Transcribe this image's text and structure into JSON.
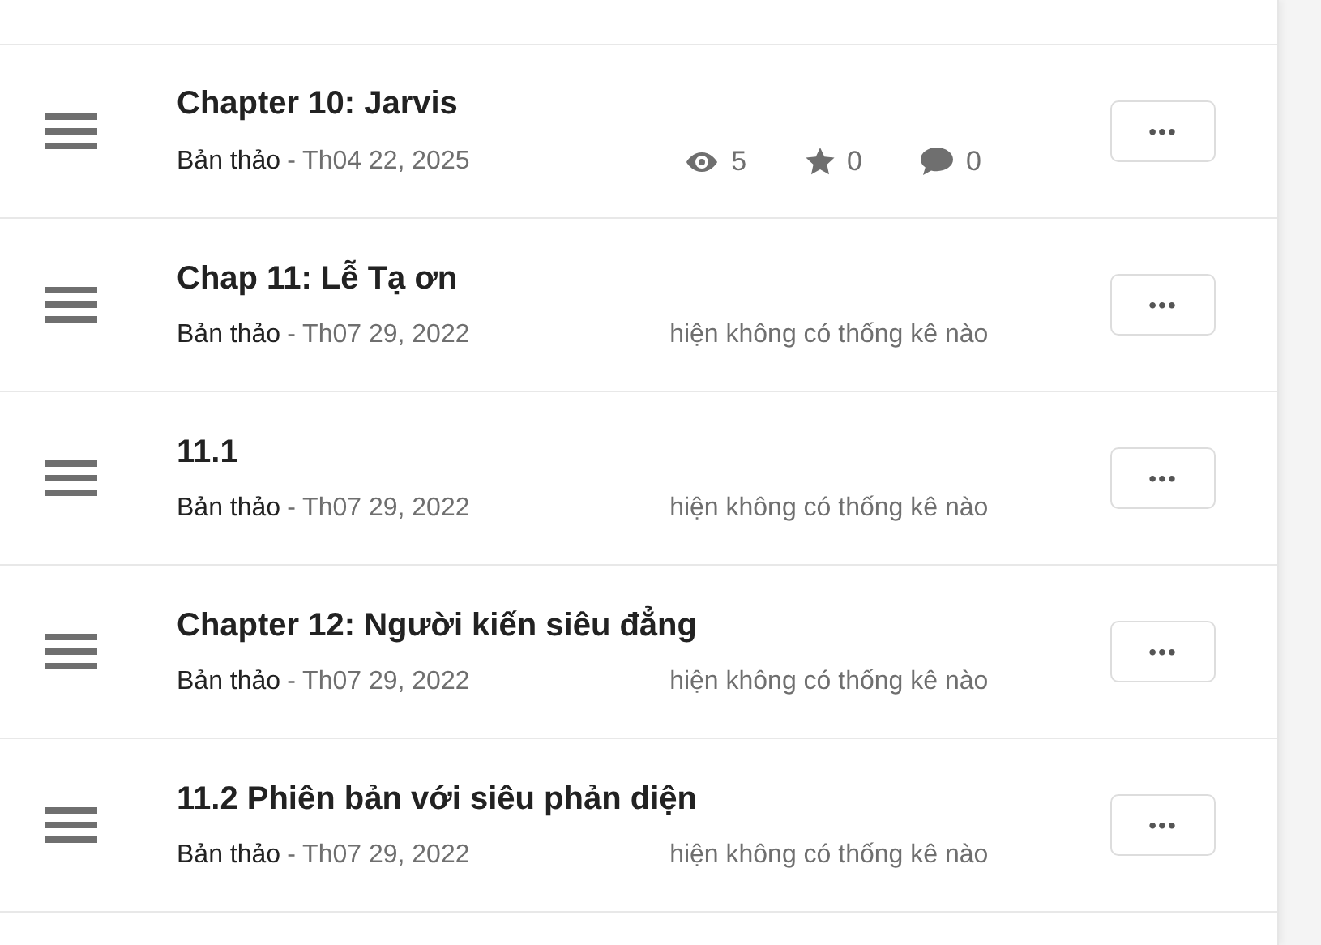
{
  "chapters": [
    {
      "title": "Chapter 10: Jarvis",
      "status": "Bản thảo",
      "date": "- Th04 22, 2025",
      "kind": "stats",
      "views": "5",
      "votes": "0",
      "comments": "0",
      "more": "•••"
    },
    {
      "title": "Chap 11: Lễ Tạ ơn",
      "status": "Bản thảo",
      "date": "- Th07 29, 2022",
      "kind": "none",
      "no_stats": "hiện không có thống kê nào",
      "more": "•••"
    },
    {
      "title": "11.1",
      "status": "Bản thảo",
      "date": "- Th07 29, 2022",
      "kind": "none",
      "no_stats": "hiện không có thống kê nào",
      "more": "•••"
    },
    {
      "title": "Chapter 12: Người kiến siêu đẳng",
      "status": "Bản thảo",
      "date": "- Th07 29, 2022",
      "kind": "none",
      "no_stats": "hiện không có thống kê nào",
      "more": "•••"
    },
    {
      "title": "11.2 Phiên bản với siêu phản diện",
      "status": "Bản thảo",
      "date": "- Th07 29, 2022",
      "kind": "none",
      "no_stats": "hiện không có thống kê nào",
      "more": "•••"
    }
  ]
}
